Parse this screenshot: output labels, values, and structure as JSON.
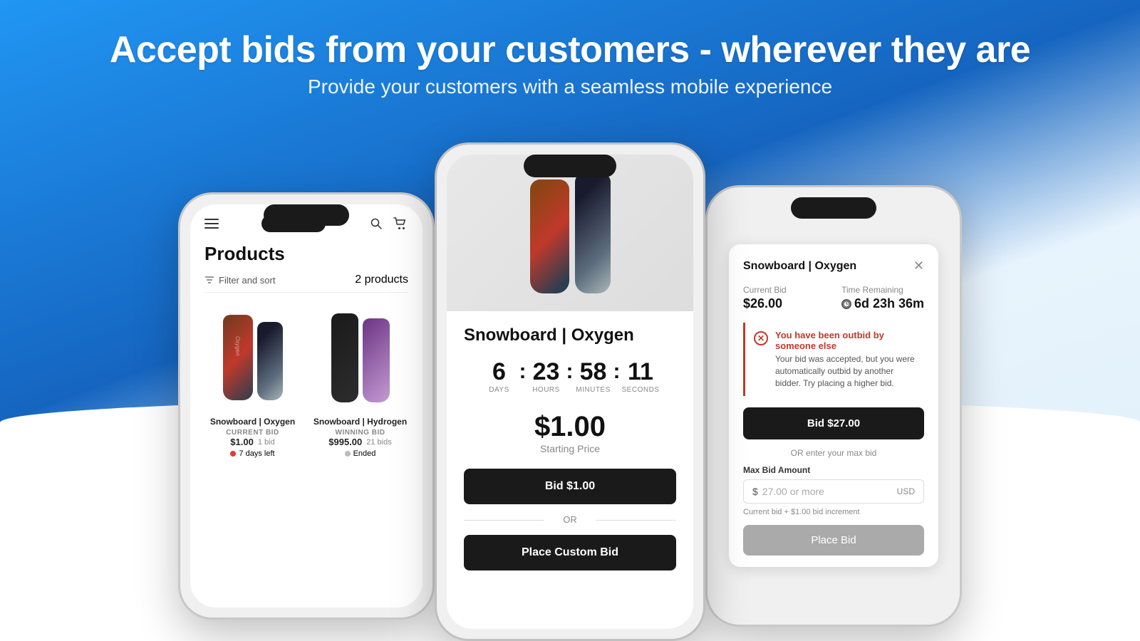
{
  "header": {
    "title": "Accept bids from your customers - wherever they are",
    "subtitle": "Provide your customers with a seamless mobile experience"
  },
  "phone_left": {
    "page_title": "Products",
    "filter_label": "Filter and sort",
    "products_count": "2 products",
    "products": [
      {
        "name": "Snowboard | Oxygen",
        "bid_label": "CURRENT BID",
        "price": "$1.00",
        "bids": "1 bid",
        "status": "7 days left",
        "status_type": "active"
      },
      {
        "name": "Snowboard | Hydrogen",
        "bid_label": "WINNING BID",
        "price": "$995.00",
        "bids": "21 bids",
        "status": "Ended",
        "status_type": "ended"
      }
    ]
  },
  "phone_middle": {
    "product_title": "Snowboard | Oxygen",
    "countdown": {
      "days": "6",
      "hours": "23",
      "minutes": "58",
      "seconds": "11",
      "days_label": "DAYS",
      "hours_label": "HOURS",
      "minutes_label": "MINUTES",
      "seconds_label": "SECONDS"
    },
    "starting_price": "$1.00",
    "starting_price_label": "Starting Price",
    "bid_button": "Bid $1.00",
    "or_label": "OR",
    "custom_bid_button": "Place Custom Bid"
  },
  "phone_right": {
    "modal_title": "Snowboard | Oxygen",
    "current_bid_label": "Current Bid",
    "current_bid_value": "$26.00",
    "time_remaining_label": "Time Remaining",
    "time_remaining_value": "6d 23h 36m",
    "outbid": {
      "title": "You have been outbid by someone else",
      "message": "Your bid was accepted, but you were automatically outbid by another bidder. Try placing a higher bid."
    },
    "bid_button": "Bid $27.00",
    "or_enter_label": "OR enter your max bid",
    "max_bid_label": "Max Bid Amount",
    "max_bid_placeholder": "27.00 or more",
    "max_bid_currency": "USD",
    "increment_note": "Current bid + $1.00 bid increment",
    "place_bid_button": "Place Bid"
  }
}
